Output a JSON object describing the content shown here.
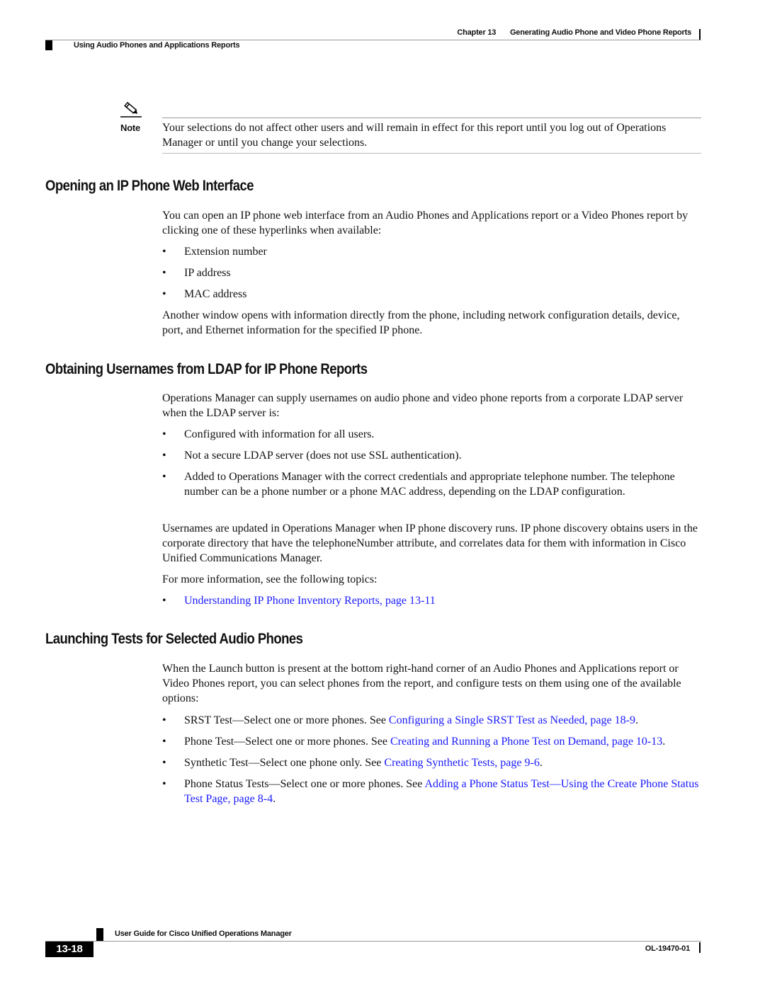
{
  "header": {
    "chapter": "Chapter 13",
    "chapter_title": "Generating Audio Phone and Video Phone Reports",
    "section": "Using Audio Phones and Applications Reports"
  },
  "note": {
    "label": "Note",
    "icon": "pencil-icon",
    "text": "Your selections do not affect other users and will remain in effect for this report until you log out of Operations Manager or until you change your selections."
  },
  "sections": [
    {
      "title": "Opening an IP Phone Web Interface",
      "intro": "You can open an IP phone web interface from an Audio Phones and Applications report or a Video Phones report by clicking one of these hyperlinks when available:",
      "bullets": [
        "Extension number",
        "IP address",
        "MAC address"
      ],
      "outro": "Another window opens with information directly from the phone, including network configuration details, device, port, and Ethernet information for the specified IP phone."
    },
    {
      "title": "Obtaining Usernames from LDAP for IP Phone Reports",
      "intro": "Operations Manager can supply usernames on audio phone and video phone reports from a corporate LDAP server when the LDAP server is:",
      "bullets": [
        "Configured with information for all users.",
        "Not a secure LDAP server (does not use SSL authentication).",
        "Added to Operations Manager with the correct credentials and appropriate telephone number. The telephone number can be a phone number or a phone MAC address, depending on the LDAP configuration."
      ],
      "para2": "Usernames are updated in Operations Manager when IP phone discovery runs. IP phone discovery obtains users in the corporate directory that have the telephoneNumber attribute, and correlates data for them with information in Cisco Unified Communications Manager.",
      "para3": "For more information, see the following topics:",
      "link": "Understanding IP Phone Inventory Reports, page 13-11"
    },
    {
      "title": "Launching Tests for Selected Audio Phones",
      "intro": "When the Launch button is present at the bottom right-hand corner of an Audio Phones and Applications report or Video Phones report, you can select phones from the report, and configure tests on them using one of the available options:",
      "items": [
        {
          "text": "SRST Test—Select one or more phones. See ",
          "link": "Configuring a Single SRST Test as Needed, page 18-9",
          "after": "."
        },
        {
          "text": "Phone Test—Select one or more phones. See ",
          "link": "Creating and Running a Phone Test on Demand, page 10-13",
          "after": "."
        },
        {
          "text": "Synthetic Test—Select one phone only. See ",
          "link": "Creating Synthetic Tests, page 9-6",
          "after": "."
        },
        {
          "text": "Phone Status Tests—Select one or more phones. See ",
          "link": "Adding a Phone Status Test—Using the Create Phone Status Test Page, page 8-4",
          "after": "."
        }
      ]
    }
  ],
  "footer": {
    "guide_title": "User Guide for Cisco Unified Operations Manager",
    "page_number": "13-18",
    "doc_id": "OL-19470-01"
  },
  "bullet_char": "•"
}
